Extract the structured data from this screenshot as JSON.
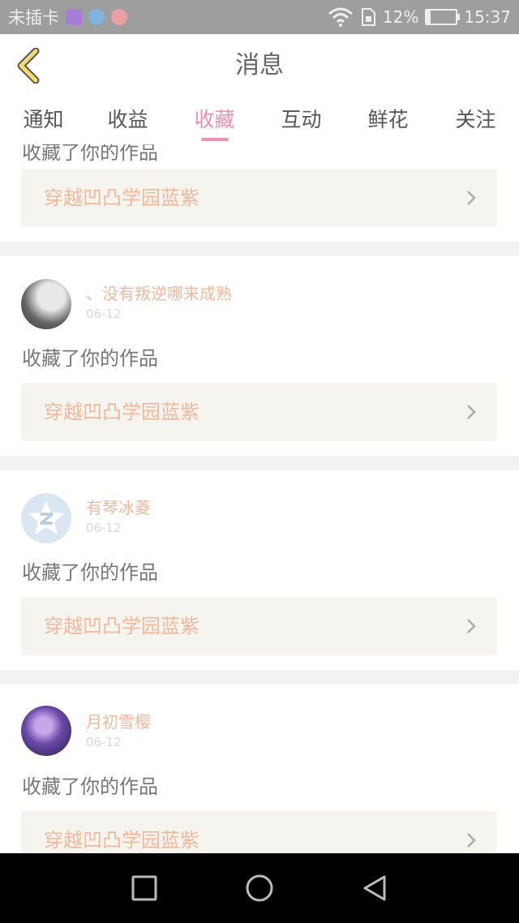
{
  "status_bar": {
    "carrier": "未插卡",
    "battery": "12%",
    "battery_level": 0.12,
    "time": "15:37",
    "icons": [
      "gallery-app-icon",
      "browser-app-icon",
      "store-app-icon",
      "wifi-icon",
      "sim-icon",
      "battery-icon"
    ]
  },
  "header": {
    "title": "消息",
    "back_icon": "chevron-left-icon"
  },
  "tabs": [
    {
      "label": "通知",
      "active": false
    },
    {
      "label": "收益",
      "active": false
    },
    {
      "label": "收藏",
      "active": true
    },
    {
      "label": "互动",
      "active": false
    },
    {
      "label": "鲜花",
      "active": false
    },
    {
      "label": "关注",
      "active": false
    }
  ],
  "items": [
    {
      "user": "",
      "date": "",
      "action": "收藏了你的作品",
      "work": "穿越凹凸学园蓝紫"
    },
    {
      "user": "、没有叛逆哪来成熟",
      "date": "06-12",
      "action": "收藏了你的作品",
      "work": "穿越凹凸学园蓝紫"
    },
    {
      "user": "有琴冰菱",
      "date": "06-12",
      "action": "收藏了你的作品",
      "work": "穿越凹凸学园蓝紫"
    },
    {
      "user": "月初雪樱",
      "date": "06-12",
      "action": "收藏了你的作品",
      "work": "穿越凹凸学园蓝紫"
    }
  ],
  "colors": {
    "accent": "#ef8fb0",
    "username": "#f2b89a",
    "back_icon": "#f2dd6a"
  },
  "nav": [
    "recent-apps-icon",
    "home-icon",
    "back-icon"
  ]
}
